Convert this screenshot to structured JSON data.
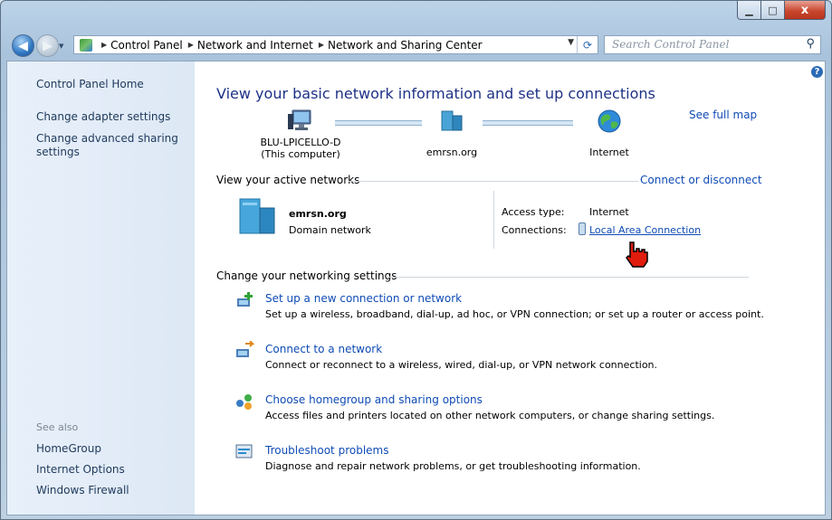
{
  "window": {
    "close_label": "x"
  },
  "address_bar": {
    "crumbs": [
      "Control Panel",
      "Network and Internet",
      "Network and Sharing Center"
    ]
  },
  "search": {
    "placeholder": "Search Control Panel"
  },
  "sidebar": {
    "items": [
      "Control Panel Home",
      "Change adapter settings",
      "Change advanced sharing settings"
    ],
    "see_also_label": "See also",
    "see_also": [
      "HomeGroup",
      "Internet Options",
      "Windows Firewall"
    ]
  },
  "main": {
    "heading": "View your basic network information and set up connections",
    "see_full_map": "See full map",
    "map": {
      "computer_name": "BLU-LPICELLO-D",
      "computer_sub": "(This computer)",
      "domain": "emrsn.org",
      "internet": "Internet"
    },
    "active_networks": {
      "label": "View your active networks",
      "connect_link": "Connect or disconnect",
      "network_name": "emrsn.org",
      "network_type": "Domain network",
      "access_type_label": "Access type:",
      "access_type_value": "Internet",
      "connections_label": "Connections:",
      "connection_link": "Local Area Connection"
    },
    "networking_settings": {
      "label": "Change your networking settings",
      "tasks": [
        {
          "title": "Set up a new connection or network",
          "desc": "Set up a wireless, broadband, dial-up, ad hoc, or VPN connection; or set up a router or access point."
        },
        {
          "title": "Connect to a network",
          "desc": "Connect or reconnect to a wireless, wired, dial-up, or VPN network connection."
        },
        {
          "title": "Choose homegroup and sharing options",
          "desc": "Access files and printers located on other network computers, or change sharing settings."
        },
        {
          "title": "Troubleshoot problems",
          "desc": "Diagnose and repair network problems, or get troubleshooting information."
        }
      ]
    }
  },
  "colors": {
    "link": "#0f4bb5",
    "heading": "#1e3287",
    "sidebar_bg": "#e8f0fa"
  }
}
